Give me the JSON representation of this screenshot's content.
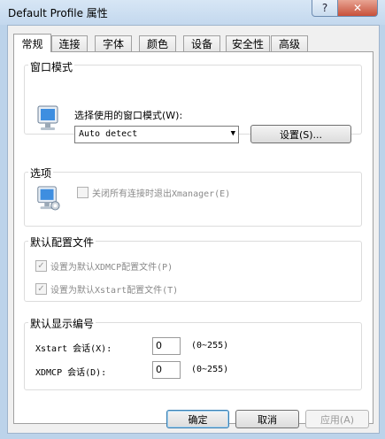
{
  "window": {
    "title": "Default Profile 属性",
    "help_glyph": "?",
    "close_glyph": "✕"
  },
  "tabs": [
    {
      "label": "常规",
      "active": true
    },
    {
      "label": "连接"
    },
    {
      "label": "字体"
    },
    {
      "label": "颜色"
    },
    {
      "label": "设备"
    },
    {
      "label": "安全性"
    },
    {
      "label": "高级"
    }
  ],
  "window_mode": {
    "group_title": "窗口模式",
    "select_label": "选择使用的窗口模式(W):",
    "select_value": "Auto detect",
    "settings_button": "设置(S)..."
  },
  "options": {
    "group_title": "选项",
    "exit_checkbox": {
      "label": "关闭所有连接时退出Xmanager(E)",
      "checked": false
    }
  },
  "default_config": {
    "group_title": "默认配置文件",
    "xdmcp_checkbox": {
      "label": "设置为默认XDMCP配置文件(P)",
      "checked": true
    },
    "xstart_checkbox": {
      "label": "设置为默认Xstart配置文件(T)",
      "checked": true
    }
  },
  "display_number": {
    "group_title": "默认显示编号",
    "xstart": {
      "label": "Xstart 会话(X):",
      "value": "0",
      "range": "(0~255)"
    },
    "xdmcp": {
      "label": "XDMCP 会话(D):",
      "value": "0",
      "range": "(0~255)"
    }
  },
  "footer": {
    "ok": "确定",
    "cancel": "取消",
    "apply": "应用(A)"
  },
  "colors": {
    "titlebar": "#c9dcf0",
    "close_button": "#c7503a",
    "default_button_border": "#3c7fb1"
  }
}
